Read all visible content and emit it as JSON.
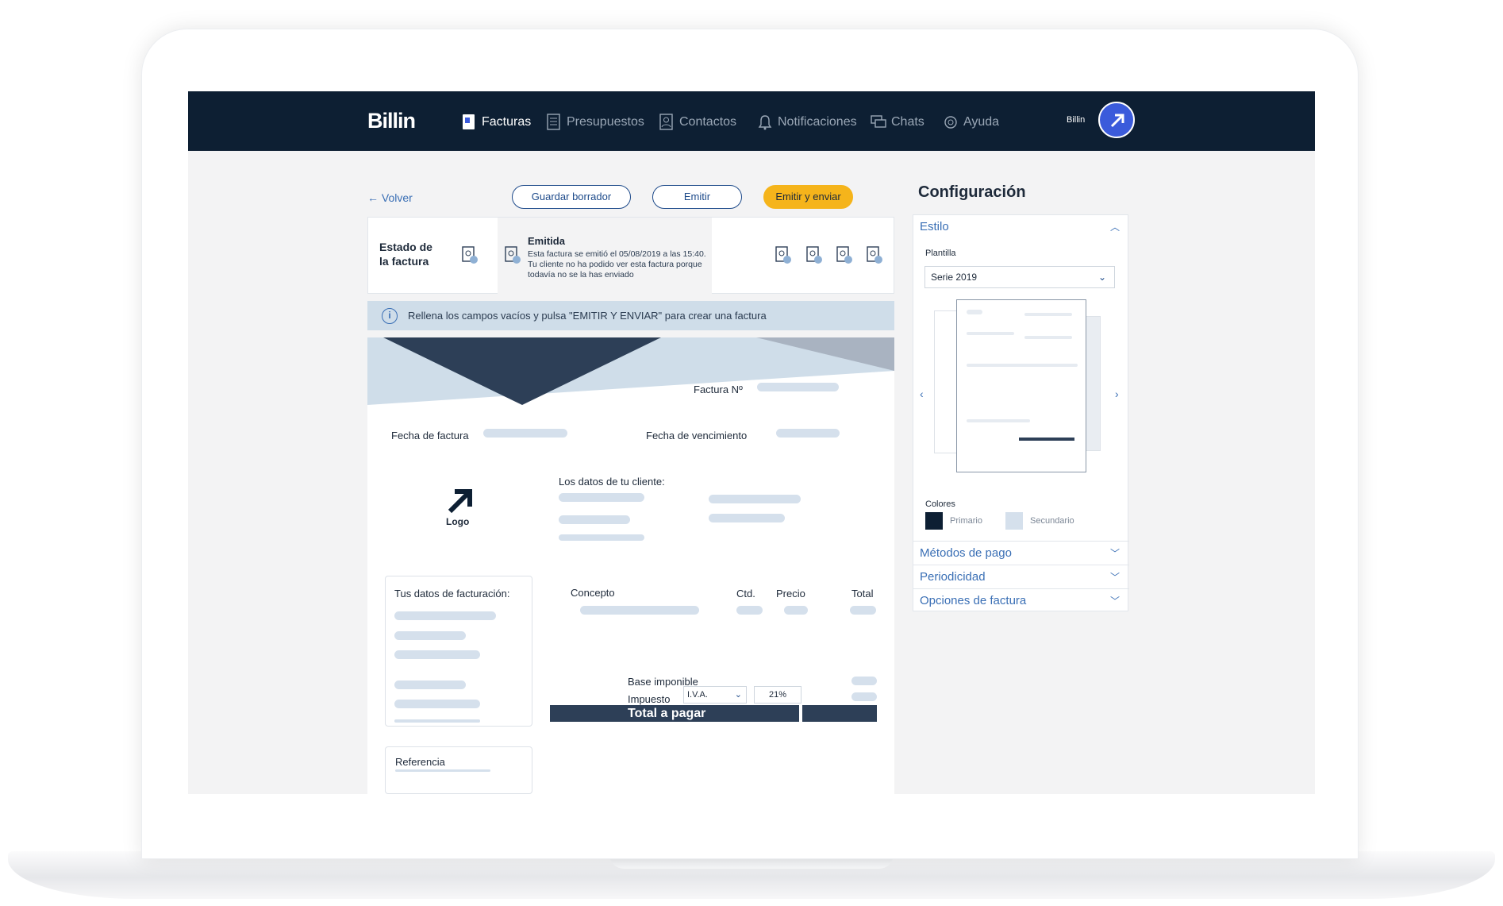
{
  "app": {
    "logo": "Billin"
  },
  "nav": {
    "items": [
      {
        "label": "Facturas",
        "icon": "invoice-icon",
        "active": true
      },
      {
        "label": "Presupuestos",
        "icon": "budget-icon",
        "active": false
      },
      {
        "label": "Contactos",
        "icon": "contacts-icon",
        "active": false
      },
      {
        "label": "Notificaciones",
        "icon": "bell-icon",
        "active": false
      },
      {
        "label": "Chats",
        "icon": "chat-icon",
        "active": false
      },
      {
        "label": "Ayuda",
        "icon": "help-icon",
        "active": false
      }
    ],
    "user": "Billin"
  },
  "toolbar": {
    "back": "← Volver",
    "save_draft": "Guardar borrador",
    "issue": "Emitir",
    "issue_send": "Emitir y enviar"
  },
  "status": {
    "title": "Estado de la factura",
    "current": "Emitida",
    "description": "Esta factura se emitió el 05/08/2019 a las 15:40. Tu cliente no ha podido ver esta factura porque todavía no se la has enviado"
  },
  "info": {
    "message": "Rellena los campos vacíos y pulsa \"EMITIR Y ENVIAR\" para crear una factura"
  },
  "invoice": {
    "number_label": "Factura Nº",
    "date_label": "Fecha de factura",
    "due_label": "Fecha de vencimiento",
    "logo_label": "Logo",
    "client_label": "Los datos de tu cliente:",
    "billing_label": "Tus datos de facturación:",
    "reference_label": "Referencia",
    "columns": {
      "concept": "Concepto",
      "qty": "Ctd.",
      "price": "Precio",
      "total": "Total"
    },
    "base_label": "Base imponible",
    "tax_label": "Impuesto",
    "tax_type": "I.V.A.",
    "tax_rate": "21%",
    "total_label": "Total a pagar"
  },
  "config": {
    "title": "Configuración",
    "style": {
      "label": "Estilo",
      "template_label": "Plantilla",
      "template_value": "Serie 2019",
      "colors_label": "Colores",
      "primary": "Primario",
      "secondary": "Secundario",
      "primary_color": "#0d1f33",
      "secondary_color": "#d5e0ec"
    },
    "sections": [
      "Métodos de pago",
      "Periodicidad",
      "Opciones de factura"
    ]
  },
  "colors": {
    "nav": "#0d1f33",
    "accent": "#f5b41b",
    "link": "#3a6fb5"
  }
}
